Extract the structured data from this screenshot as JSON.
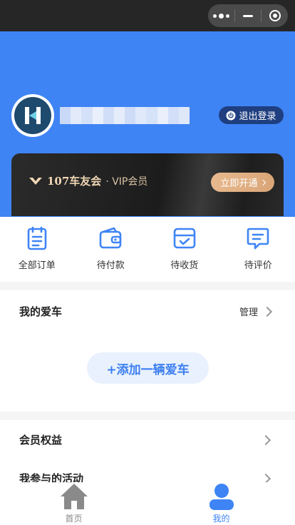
{
  "capsule": {
    "more_icon": "more-dots-icon",
    "minimize_icon": "minimize-icon",
    "close_icon": "target-icon"
  },
  "profile": {
    "logout_label": "退出登录"
  },
  "vip": {
    "brand": "107车友会",
    "subtitle": "· VIP会员",
    "cta_label": "立即开通"
  },
  "orders": [
    {
      "label": "全部订单",
      "icon": "clipboard-icon"
    },
    {
      "label": "待付款",
      "icon": "wallet-icon"
    },
    {
      "label": "待收货",
      "icon": "box-icon"
    },
    {
      "label": "待评价",
      "icon": "comment-icon"
    }
  ],
  "my_car": {
    "title": "我的爱车",
    "manage_label": "管理",
    "add_label": "+添加一辆爱车"
  },
  "menu": [
    {
      "label": "会员权益"
    },
    {
      "label": "我参与的活动"
    }
  ],
  "tabbar": {
    "home_label": "首页",
    "mine_label": "我的"
  },
  "colors": {
    "primary": "#3f84f5",
    "vip_gold": "#e0ad80",
    "dark": "#1f3f80"
  }
}
